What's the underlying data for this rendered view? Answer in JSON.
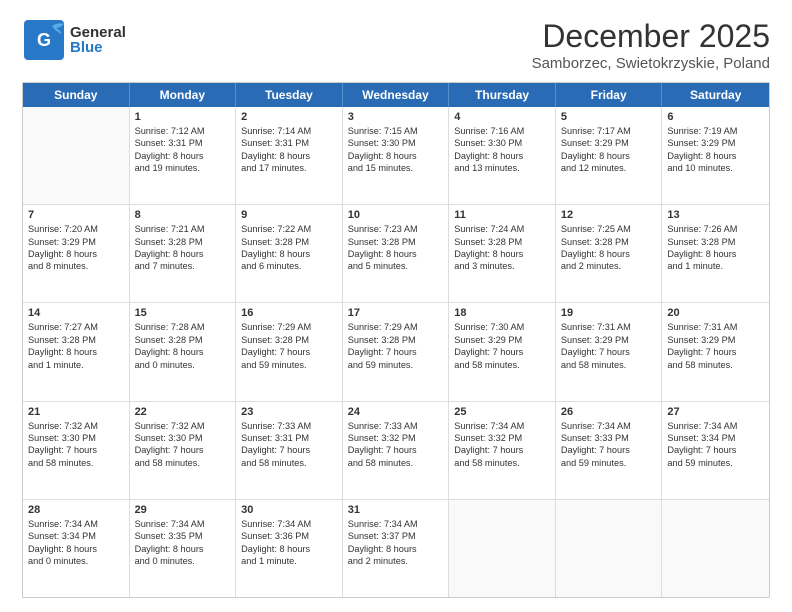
{
  "header": {
    "logo_general": "General",
    "logo_blue": "Blue",
    "month_title": "December 2025",
    "location": "Samborzec, Swietokrzyskie, Poland"
  },
  "days_of_week": [
    "Sunday",
    "Monday",
    "Tuesday",
    "Wednesday",
    "Thursday",
    "Friday",
    "Saturday"
  ],
  "weeks": [
    [
      {
        "day": "",
        "lines": []
      },
      {
        "day": "1",
        "lines": [
          "Sunrise: 7:12 AM",
          "Sunset: 3:31 PM",
          "Daylight: 8 hours",
          "and 19 minutes."
        ]
      },
      {
        "day": "2",
        "lines": [
          "Sunrise: 7:14 AM",
          "Sunset: 3:31 PM",
          "Daylight: 8 hours",
          "and 17 minutes."
        ]
      },
      {
        "day": "3",
        "lines": [
          "Sunrise: 7:15 AM",
          "Sunset: 3:30 PM",
          "Daylight: 8 hours",
          "and 15 minutes."
        ]
      },
      {
        "day": "4",
        "lines": [
          "Sunrise: 7:16 AM",
          "Sunset: 3:30 PM",
          "Daylight: 8 hours",
          "and 13 minutes."
        ]
      },
      {
        "day": "5",
        "lines": [
          "Sunrise: 7:17 AM",
          "Sunset: 3:29 PM",
          "Daylight: 8 hours",
          "and 12 minutes."
        ]
      },
      {
        "day": "6",
        "lines": [
          "Sunrise: 7:19 AM",
          "Sunset: 3:29 PM",
          "Daylight: 8 hours",
          "and 10 minutes."
        ]
      }
    ],
    [
      {
        "day": "7",
        "lines": [
          "Sunrise: 7:20 AM",
          "Sunset: 3:29 PM",
          "Daylight: 8 hours",
          "and 8 minutes."
        ]
      },
      {
        "day": "8",
        "lines": [
          "Sunrise: 7:21 AM",
          "Sunset: 3:28 PM",
          "Daylight: 8 hours",
          "and 7 minutes."
        ]
      },
      {
        "day": "9",
        "lines": [
          "Sunrise: 7:22 AM",
          "Sunset: 3:28 PM",
          "Daylight: 8 hours",
          "and 6 minutes."
        ]
      },
      {
        "day": "10",
        "lines": [
          "Sunrise: 7:23 AM",
          "Sunset: 3:28 PM",
          "Daylight: 8 hours",
          "and 5 minutes."
        ]
      },
      {
        "day": "11",
        "lines": [
          "Sunrise: 7:24 AM",
          "Sunset: 3:28 PM",
          "Daylight: 8 hours",
          "and 3 minutes."
        ]
      },
      {
        "day": "12",
        "lines": [
          "Sunrise: 7:25 AM",
          "Sunset: 3:28 PM",
          "Daylight: 8 hours",
          "and 2 minutes."
        ]
      },
      {
        "day": "13",
        "lines": [
          "Sunrise: 7:26 AM",
          "Sunset: 3:28 PM",
          "Daylight: 8 hours",
          "and 1 minute."
        ]
      }
    ],
    [
      {
        "day": "14",
        "lines": [
          "Sunrise: 7:27 AM",
          "Sunset: 3:28 PM",
          "Daylight: 8 hours",
          "and 1 minute."
        ]
      },
      {
        "day": "15",
        "lines": [
          "Sunrise: 7:28 AM",
          "Sunset: 3:28 PM",
          "Daylight: 8 hours",
          "and 0 minutes."
        ]
      },
      {
        "day": "16",
        "lines": [
          "Sunrise: 7:29 AM",
          "Sunset: 3:28 PM",
          "Daylight: 7 hours",
          "and 59 minutes."
        ]
      },
      {
        "day": "17",
        "lines": [
          "Sunrise: 7:29 AM",
          "Sunset: 3:28 PM",
          "Daylight: 7 hours",
          "and 59 minutes."
        ]
      },
      {
        "day": "18",
        "lines": [
          "Sunrise: 7:30 AM",
          "Sunset: 3:29 PM",
          "Daylight: 7 hours",
          "and 58 minutes."
        ]
      },
      {
        "day": "19",
        "lines": [
          "Sunrise: 7:31 AM",
          "Sunset: 3:29 PM",
          "Daylight: 7 hours",
          "and 58 minutes."
        ]
      },
      {
        "day": "20",
        "lines": [
          "Sunrise: 7:31 AM",
          "Sunset: 3:29 PM",
          "Daylight: 7 hours",
          "and 58 minutes."
        ]
      }
    ],
    [
      {
        "day": "21",
        "lines": [
          "Sunrise: 7:32 AM",
          "Sunset: 3:30 PM",
          "Daylight: 7 hours",
          "and 58 minutes."
        ]
      },
      {
        "day": "22",
        "lines": [
          "Sunrise: 7:32 AM",
          "Sunset: 3:30 PM",
          "Daylight: 7 hours",
          "and 58 minutes."
        ]
      },
      {
        "day": "23",
        "lines": [
          "Sunrise: 7:33 AM",
          "Sunset: 3:31 PM",
          "Daylight: 7 hours",
          "and 58 minutes."
        ]
      },
      {
        "day": "24",
        "lines": [
          "Sunrise: 7:33 AM",
          "Sunset: 3:32 PM",
          "Daylight: 7 hours",
          "and 58 minutes."
        ]
      },
      {
        "day": "25",
        "lines": [
          "Sunrise: 7:34 AM",
          "Sunset: 3:32 PM",
          "Daylight: 7 hours",
          "and 58 minutes."
        ]
      },
      {
        "day": "26",
        "lines": [
          "Sunrise: 7:34 AM",
          "Sunset: 3:33 PM",
          "Daylight: 7 hours",
          "and 59 minutes."
        ]
      },
      {
        "day": "27",
        "lines": [
          "Sunrise: 7:34 AM",
          "Sunset: 3:34 PM",
          "Daylight: 7 hours",
          "and 59 minutes."
        ]
      }
    ],
    [
      {
        "day": "28",
        "lines": [
          "Sunrise: 7:34 AM",
          "Sunset: 3:34 PM",
          "Daylight: 8 hours",
          "and 0 minutes."
        ]
      },
      {
        "day": "29",
        "lines": [
          "Sunrise: 7:34 AM",
          "Sunset: 3:35 PM",
          "Daylight: 8 hours",
          "and 0 minutes."
        ]
      },
      {
        "day": "30",
        "lines": [
          "Sunrise: 7:34 AM",
          "Sunset: 3:36 PM",
          "Daylight: 8 hours",
          "and 1 minute."
        ]
      },
      {
        "day": "31",
        "lines": [
          "Sunrise: 7:34 AM",
          "Sunset: 3:37 PM",
          "Daylight: 8 hours",
          "and 2 minutes."
        ]
      },
      {
        "day": "",
        "lines": []
      },
      {
        "day": "",
        "lines": []
      },
      {
        "day": "",
        "lines": []
      }
    ]
  ]
}
